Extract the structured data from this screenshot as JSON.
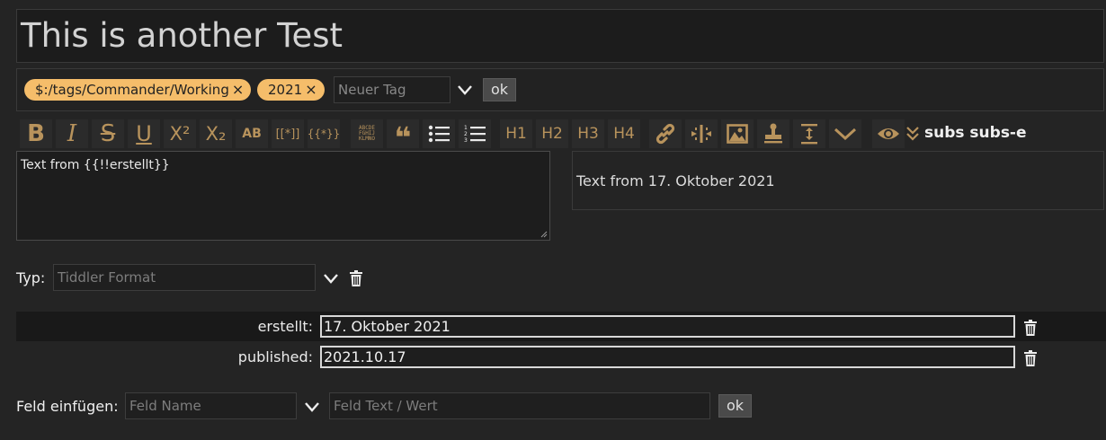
{
  "title": "This is another Test",
  "tags": {
    "items": [
      {
        "label": "$:/tags/Commander/Working"
      },
      {
        "label": "2021"
      }
    ],
    "remove_glyph": "×",
    "new_tag_placeholder": "Neuer Tag",
    "ok_label": "ok"
  },
  "toolbar": {
    "accent_color": "#b8935c",
    "buttons": [
      {
        "name": "bold",
        "label": "B"
      },
      {
        "name": "italic",
        "label": "I"
      },
      {
        "name": "strikethrough",
        "label": "S"
      },
      {
        "name": "underline",
        "label": "U"
      },
      {
        "name": "superscript",
        "label": "X²"
      },
      {
        "name": "subscript",
        "label": "X₂"
      },
      {
        "name": "smallcaps",
        "label": "AB"
      },
      {
        "name": "wikilink",
        "label": "[[*]]"
      },
      {
        "name": "transclude",
        "label": "{{*}}"
      },
      {
        "name": "monospace",
        "label": "ABCDE FGHIJ KLMNO"
      },
      {
        "name": "quote",
        "label": "❝"
      },
      {
        "name": "list-bullet",
        "label": ""
      },
      {
        "name": "list-number",
        "label": ""
      },
      {
        "name": "heading-1",
        "label": "H1"
      },
      {
        "name": "heading-2",
        "label": "H2"
      },
      {
        "name": "heading-3",
        "label": "H3"
      },
      {
        "name": "heading-4",
        "label": "H4"
      },
      {
        "name": "link",
        "label": ""
      },
      {
        "name": "excise",
        "label": ""
      },
      {
        "name": "picture",
        "label": ""
      },
      {
        "name": "stamp",
        "label": ""
      },
      {
        "name": "size",
        "label": ""
      },
      {
        "name": "more",
        "label": ""
      },
      {
        "name": "preview",
        "label": ""
      },
      {
        "name": "preview-type",
        "label": ""
      }
    ],
    "subs_label": "subs subs-e"
  },
  "editor": {
    "text": "Text from {{!!erstellt}}"
  },
  "preview": {
    "text": "Text from 17. Oktober 2021"
  },
  "type_row": {
    "label": "Typ:",
    "placeholder": "Tiddler Format"
  },
  "fields": [
    {
      "key": "erstellt:",
      "value": "17. Oktober 2021"
    },
    {
      "key": "published:",
      "value": "2021.10.17"
    }
  ],
  "add_field": {
    "label": "Feld einfügen:",
    "name_placeholder": "Feld Name",
    "value_placeholder": "Feld Text / Wert",
    "ok_label": "ok"
  }
}
